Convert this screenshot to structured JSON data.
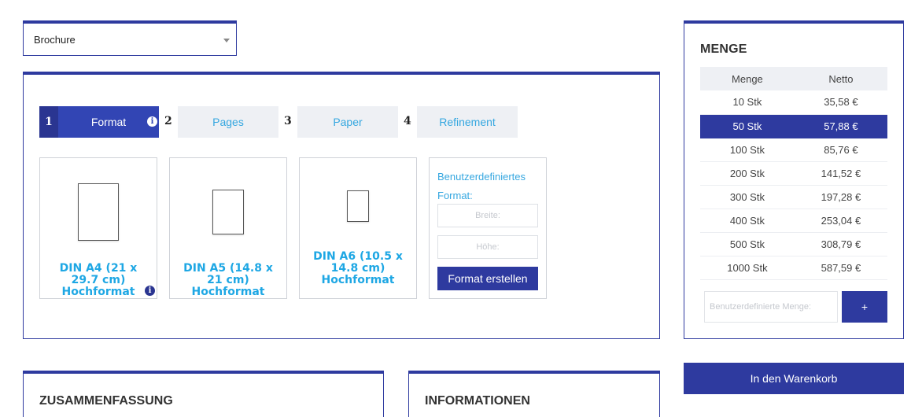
{
  "product_select": {
    "value": "Brochure"
  },
  "steps": [
    {
      "num": "1",
      "label": "Format"
    },
    {
      "num": "2",
      "label": "Pages"
    },
    {
      "num": "3",
      "label": "Paper"
    },
    {
      "num": "4",
      "label": "Refinement"
    }
  ],
  "formats": [
    {
      "label": "DIN A4 (21 x 29.7 cm) Hochformat"
    },
    {
      "label": "DIN A5 (14.8 x 21 cm) Hochformat"
    },
    {
      "label": "DIN A6 (10.5 x 14.8 cm) Hochformat"
    }
  ],
  "custom_format": {
    "title": "Benutzerdefiniertes Format:",
    "width_placeholder": "Breite:",
    "height_placeholder": "Höhe:",
    "button_label": "Format erstellen"
  },
  "quantity": {
    "heading": "MENGE",
    "col_qty": "Menge",
    "col_net": "Netto",
    "rows": [
      {
        "qty": "10 Stk",
        "net": "35,58 €"
      },
      {
        "qty": "50 Stk",
        "net": "57,88 €",
        "selected": true
      },
      {
        "qty": "100 Stk",
        "net": "85,76 €"
      },
      {
        "qty": "200 Stk",
        "net": "141,52 €"
      },
      {
        "qty": "300 Stk",
        "net": "197,28 €"
      },
      {
        "qty": "400 Stk",
        "net": "253,04 €"
      },
      {
        "qty": "500 Stk",
        "net": "308,79 €"
      },
      {
        "qty": "1000 Stk",
        "net": "587,59 €"
      }
    ],
    "custom_placeholder": "Benutzerdefinierte Menge:",
    "plus_label": "+"
  },
  "cart_button": "In den Warenkorb",
  "summary_heading": "ZUSAMMENFASSUNG",
  "info_heading": "INFORMATIONEN",
  "icons": {
    "info": "info-icon",
    "caret": "chevron-down-icon"
  },
  "colors": {
    "brand": "#2e3a9f",
    "accent_text": "#1ea7e4"
  }
}
